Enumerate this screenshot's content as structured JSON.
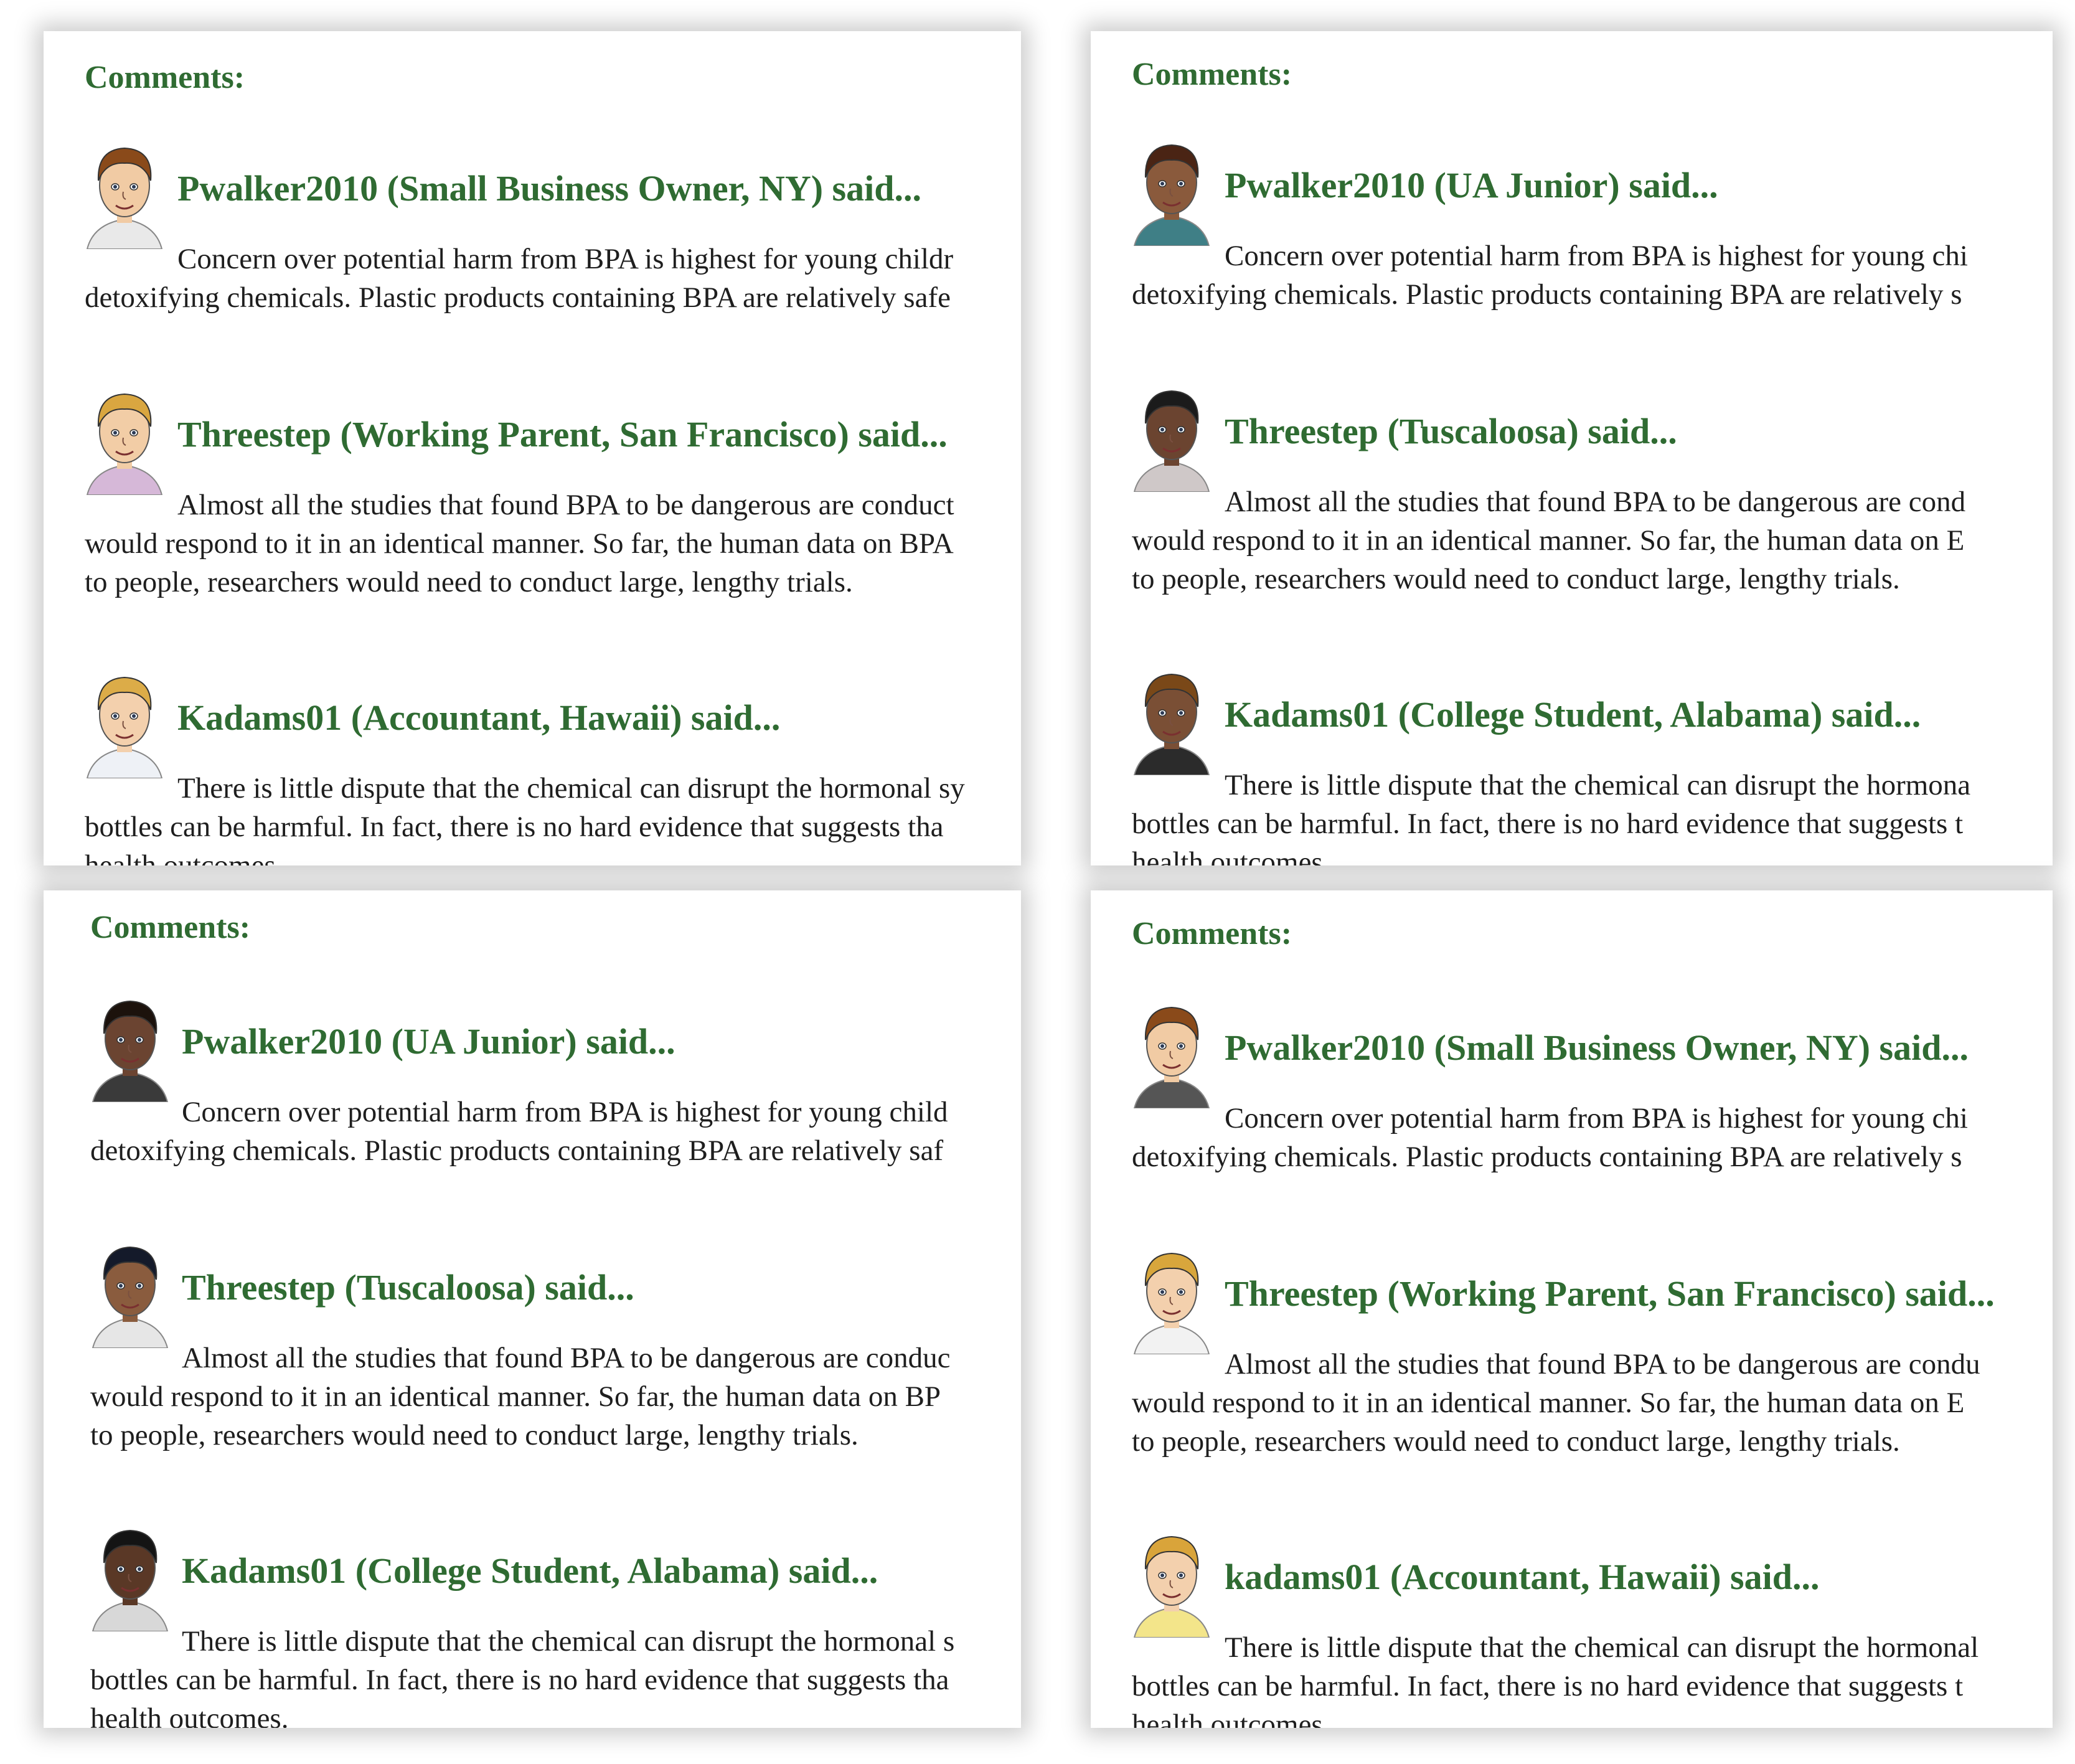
{
  "panels": [
    {
      "heading": "Comments:",
      "comments": [
        {
          "author": "Pwalker2010 (Small Business Owner, NY) said...",
          "line1": "Concern over potential harm from BPA is highest for young childr",
          "line2": "detoxifying chemicals. Plastic products containing BPA are relatively safe",
          "line3": "",
          "avatar": "avatar-icon",
          "skin": "#f1cba4",
          "hair": "#8a4a1a",
          "shirt": "#e9e9e9"
        },
        {
          "author": "Threestep (Working Parent, San Francisco) said...",
          "line1": "Almost all the studies that found BPA to be dangerous are conduct",
          "line2": "would respond to it in an identical manner. So far, the human data on BPA",
          "line3": "to people, researchers would need to conduct large, lengthy trials.",
          "avatar": "avatar-icon",
          "skin": "#f2cda6",
          "hair": "#d9a640",
          "shirt": "#d6b8d8"
        },
        {
          "author": "Kadams01 (Accountant, Hawaii) said...",
          "line1": "There is little dispute that the chemical can disrupt the hormonal sy",
          "line2": "bottles can be harmful. In fact, there is no hard evidence that suggests tha",
          "line3": "health outcomes.",
          "avatar": "avatar-icon",
          "skin": "#f3d0ad",
          "hair": "#dcac48",
          "shirt": "#eef1f6"
        }
      ]
    },
    {
      "heading": "Comments:",
      "comments": [
        {
          "author": "Pwalker2010 (UA Junior) said...",
          "line1": "Concern over potential harm from BPA is highest for young chi",
          "line2": "detoxifying chemicals. Plastic products containing BPA are relatively s",
          "line3": "",
          "avatar": "avatar-icon",
          "skin": "#8a5a3c",
          "hair": "#4a2414",
          "shirt": "#3f7f86"
        },
        {
          "author": "Threestep (Tuscaloosa) said...",
          "line1": "Almost all the studies that found BPA to be dangerous are cond",
          "line2": "would respond to it in an identical manner. So far, the human data on E",
          "line3": "to people, researchers would need to conduct large, lengthy trials.",
          "avatar": "avatar-icon",
          "skin": "#6b4430",
          "hair": "#1b1b1b",
          "shirt": "#cfc8c8"
        },
        {
          "author": "Kadams01 (College Student, Alabama) said...",
          "line1": "There is little dispute that the chemical can disrupt the hormona",
          "line2": "bottles can be harmful. In fact, there is no hard evidence that suggests t",
          "line3": "health outcomes.",
          "avatar": "avatar-icon",
          "skin": "#7a4f35",
          "hair": "#7a4818",
          "shirt": "#2b2b2b"
        }
      ]
    },
    {
      "heading": "Comments:",
      "comments": [
        {
          "author": "Pwalker2010 (UA Junior) said...",
          "line1": "Concern over potential harm from BPA is highest for young child",
          "line2": "detoxifying chemicals. Plastic products containing BPA are relatively saf",
          "line3": "",
          "avatar": "avatar-icon",
          "skin": "#6b4431",
          "hair": "#1c120c",
          "shirt": "#3a3a3a"
        },
        {
          "author": "Threestep (Tuscaloosa) said...",
          "line1": "Almost all the studies that found BPA to be dangerous are conduc",
          "line2": "would respond to it in an identical manner. So far, the human data on BP",
          "line3": "to people, researchers would need to conduct large, lengthy trials.",
          "avatar": "avatar-icon",
          "skin": "#8a5c3e",
          "hair": "#141a2a",
          "shirt": "#e6e6e6"
        },
        {
          "author": "Kadams01 (College Student, Alabama) said...",
          "line1": "There is little dispute that the chemical can disrupt the hormonal s",
          "line2": "bottles can be harmful. In fact, there is no hard evidence that suggests tha",
          "line3": "health outcomes.",
          "avatar": "avatar-icon",
          "skin": "#5a3826",
          "hair": "#141414",
          "shirt": "#d8d8d8"
        }
      ]
    },
    {
      "heading": "Comments:",
      "comments": [
        {
          "author": "Pwalker2010 (Small Business Owner, NY) said...",
          "line1": "Concern over potential harm from BPA is highest for young chi",
          "line2": "detoxifying chemicals. Plastic products containing BPA are relatively s",
          "line3": "",
          "avatar": "avatar-icon",
          "skin": "#f1cba4",
          "hair": "#8a4a1a",
          "shirt": "#555555"
        },
        {
          "author": "Threestep (Working Parent, San Francisco) said...",
          "line1": "Almost all the studies that found BPA to be dangerous are condu",
          "line2": "would respond to it in an identical manner. So far, the human data on E",
          "line3": "to people, researchers would need to conduct large, lengthy trials.",
          "avatar": "avatar-icon",
          "skin": "#f3d0ad",
          "hair": "#d8a63c",
          "shirt": "#f2f2f2"
        },
        {
          "author": "kadams01 (Accountant, Hawaii) said...",
          "line1": "There is little dispute that the chemical can disrupt the hormonal",
          "line2": "bottles can be harmful. In fact, there is no hard evidence that suggests t",
          "line3": "health outcomes.",
          "avatar": "avatar-icon",
          "skin": "#f3d0ad",
          "hair": "#d9a43a",
          "shirt": "#f3e58a"
        }
      ]
    }
  ]
}
